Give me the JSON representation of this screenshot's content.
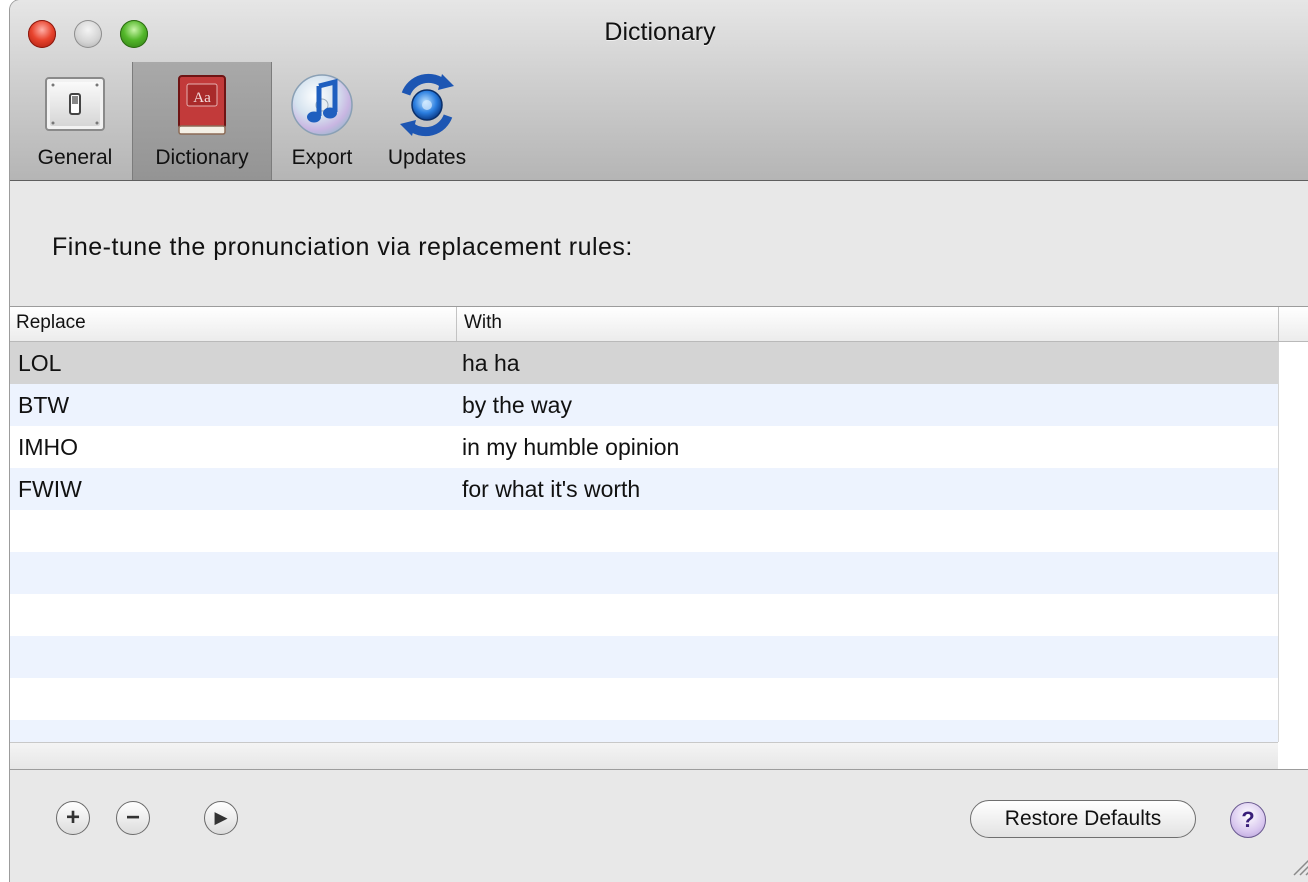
{
  "window": {
    "title": "Dictionary"
  },
  "toolbar": {
    "items": [
      {
        "label": "General",
        "icon": "switch-panel-icon"
      },
      {
        "label": "Dictionary",
        "icon": "dictionary-book-icon",
        "selected": true
      },
      {
        "label": "Export",
        "icon": "itunes-cd-icon"
      },
      {
        "label": "Updates",
        "icon": "sync-globe-icon"
      }
    ]
  },
  "main": {
    "instructions": "Fine-tune the pronunciation via replacement rules:",
    "table": {
      "columns": [
        "Replace",
        "With"
      ],
      "rows": [
        {
          "replace": "LOL",
          "with": "ha ha"
        },
        {
          "replace": "BTW",
          "with": "by the way"
        },
        {
          "replace": "IMHO",
          "with": "in my humble opinion"
        },
        {
          "replace": "FWIW",
          "with": "for what it's worth"
        }
      ]
    }
  },
  "buttons": {
    "add": "+",
    "remove": "−",
    "play": "▶",
    "restore_defaults": "Restore Defaults",
    "help": "?"
  },
  "colors": {
    "row_selected": "#d4d4d4",
    "row_alternate": "#edf3fe",
    "row_plain": "#ffffff"
  }
}
